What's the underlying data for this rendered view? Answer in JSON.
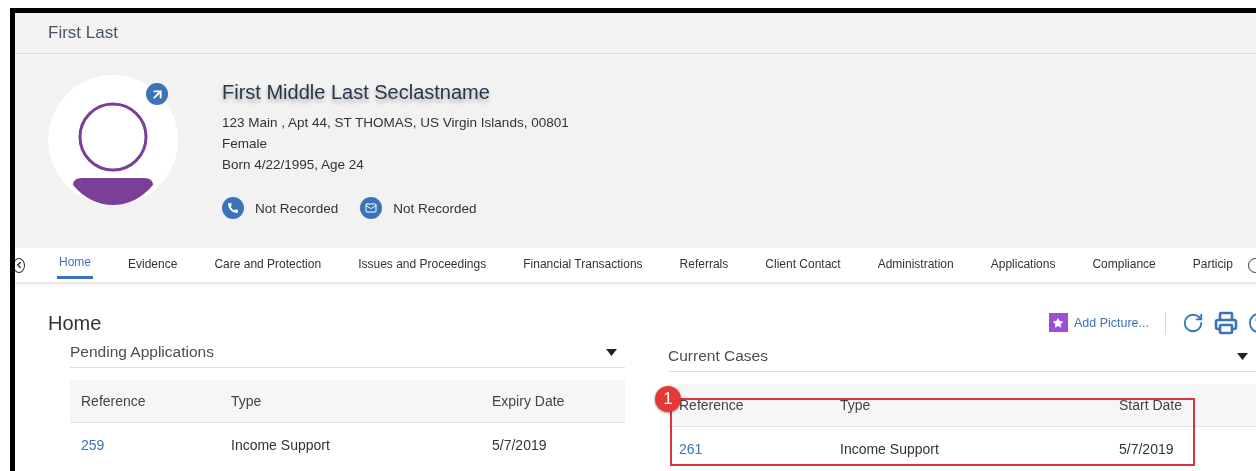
{
  "window": {
    "title": "First Last"
  },
  "person": {
    "name": "First Middle Last Seclastname",
    "address": "123 Main , Apt 44, ST THOMAS, US Virgin Islands, 00801",
    "gender": "Female",
    "born": "Born 4/22/1995, Age 24",
    "contacts": [
      {
        "kind": "phone",
        "label": "Not Recorded"
      },
      {
        "kind": "email",
        "label": "Not Recorded"
      }
    ]
  },
  "tabs": [
    {
      "label": "Home",
      "selected": true
    },
    {
      "label": "Evidence",
      "selected": false
    },
    {
      "label": "Care and Protection",
      "selected": false
    },
    {
      "label": "Issues and Proceedings",
      "selected": false
    },
    {
      "label": "Financial Transactions",
      "selected": false
    },
    {
      "label": "Referrals",
      "selected": false
    },
    {
      "label": "Client Contact",
      "selected": false
    },
    {
      "label": "Administration",
      "selected": false
    },
    {
      "label": "Applications",
      "selected": false
    },
    {
      "label": "Compliance",
      "selected": false
    },
    {
      "label": "Particip",
      "selected": false
    }
  ],
  "page": {
    "title": "Home"
  },
  "toolbar": {
    "add_picture": "Add Picture..."
  },
  "panels": [
    {
      "title": "Pending Applications",
      "columns": [
        "Reference",
        "Type",
        "Expiry Date"
      ],
      "rows": [
        [
          "259",
          "Income Support",
          "5/7/2019"
        ]
      ]
    },
    {
      "title": "Current Cases",
      "columns": [
        "Reference",
        "Type",
        "Start Date"
      ],
      "rows": [
        [
          "261",
          "Income Support",
          "5/7/2019"
        ]
      ],
      "annotation": "1"
    }
  ]
}
